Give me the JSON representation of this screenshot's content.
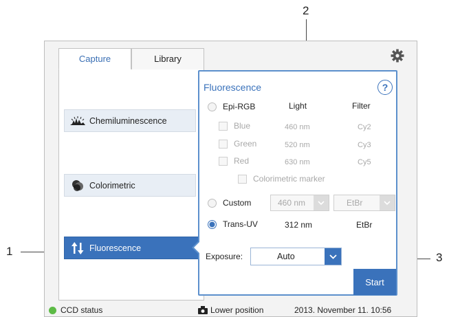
{
  "callouts": {
    "one": "1",
    "two": "2",
    "three": "3"
  },
  "tabs": {
    "capture": "Capture",
    "library": "Library"
  },
  "modes": {
    "chemi": "Chemiluminescence",
    "colorimetric": "Colorimetric",
    "fluorescence": "Fluorescence"
  },
  "panel": {
    "title": "Fluorescence",
    "help": "?",
    "col_light": "Light",
    "col_filter": "Filter",
    "epi_rgb": "Epi-RGB",
    "channels": [
      {
        "label": "Blue",
        "light": "460 nm",
        "filter": "Cy2"
      },
      {
        "label": "Green",
        "light": "520 nm",
        "filter": "Cy3"
      },
      {
        "label": "Red",
        "light": "630 nm",
        "filter": "Cy5"
      }
    ],
    "colorimetric_marker": "Colorimetric marker",
    "custom": "Custom",
    "custom_light": "460 nm",
    "custom_filter": "EtBr",
    "trans_uv": "Trans-UV",
    "trans_uv_light": "312 nm",
    "trans_uv_filter": "EtBr",
    "selected_source": "Trans-UV",
    "exposure_label": "Exposure:",
    "exposure_value": "Auto",
    "start": "Start"
  },
  "status": {
    "ccd": "CCD status",
    "position": "Lower position",
    "datetime": "2013. November 11. 10:56"
  },
  "colors": {
    "accent": "#3a72bb",
    "ok": "#5dbb46"
  }
}
